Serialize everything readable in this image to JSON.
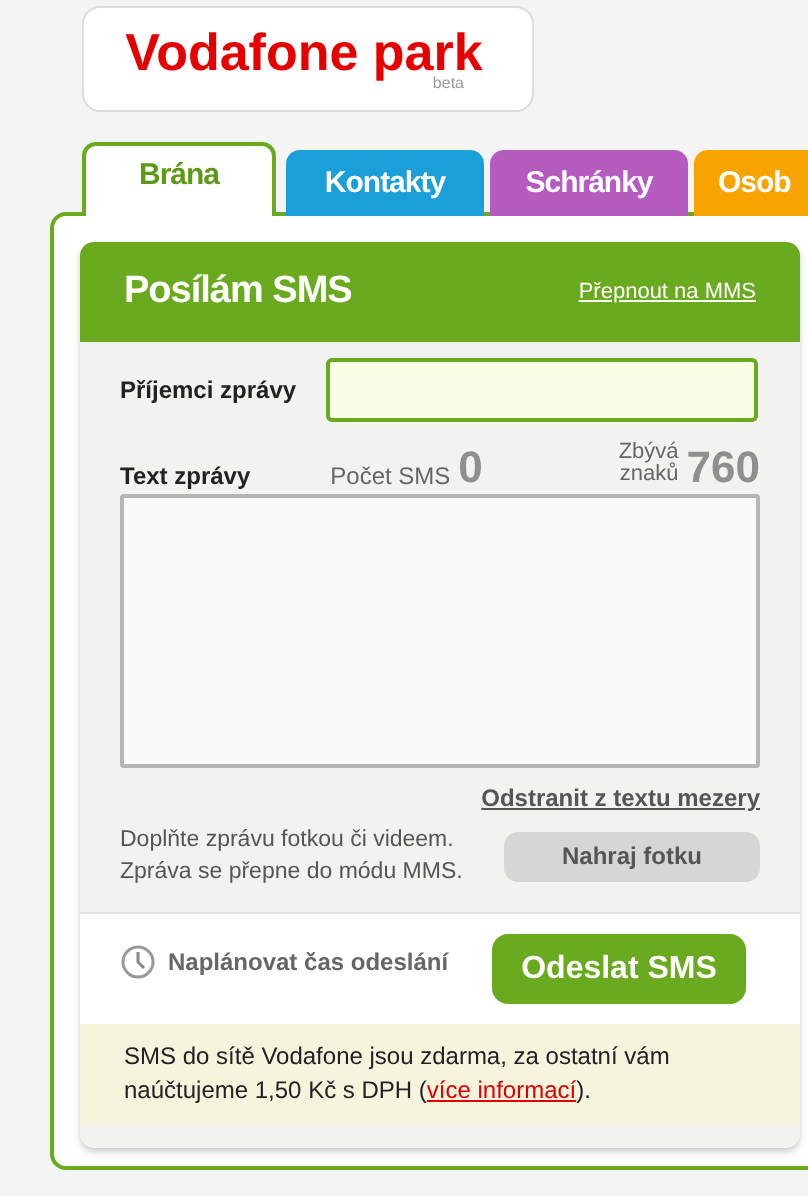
{
  "logo": {
    "name": "Vodafone park",
    "badge": "beta"
  },
  "tabs": [
    {
      "label": "Brána",
      "selected": true,
      "color": "#6aaa1e"
    },
    {
      "label": "Kontakty",
      "selected": false,
      "color": "#1a9fd9"
    },
    {
      "label": "Schránky",
      "selected": false,
      "color": "#b65cc0"
    },
    {
      "label": "Osob",
      "selected": false,
      "color": "#f7a300"
    }
  ],
  "form": {
    "title": "Posílám SMS",
    "switch_link": "Přepnout na MMS",
    "recipient": {
      "label": "Příjemci zprávy"
    },
    "message": {
      "label": "Text zprávy",
      "sms_count_label": "Počet SMS",
      "sms_count": "0",
      "remaining_label": [
        "Zbývá",
        "znaků"
      ],
      "remaining": "760"
    },
    "remove_spaces_link": "Odstranit z textu mezery",
    "photo_hint": [
      "Doplňte zprávu fotkou či videem.",
      "Zpráva se přepne do módu MMS."
    ],
    "upload_button": "Nahraj fotku",
    "schedule_link": "Naplánovat čas odeslání",
    "send_button": "Odeslat SMS",
    "info": {
      "before": "SMS do sítě Vodafone jsou zdarma, za ostatní vám naúčtujeme 1,50 Kč s DPH (",
      "link": "více informací",
      "after": ")."
    }
  }
}
